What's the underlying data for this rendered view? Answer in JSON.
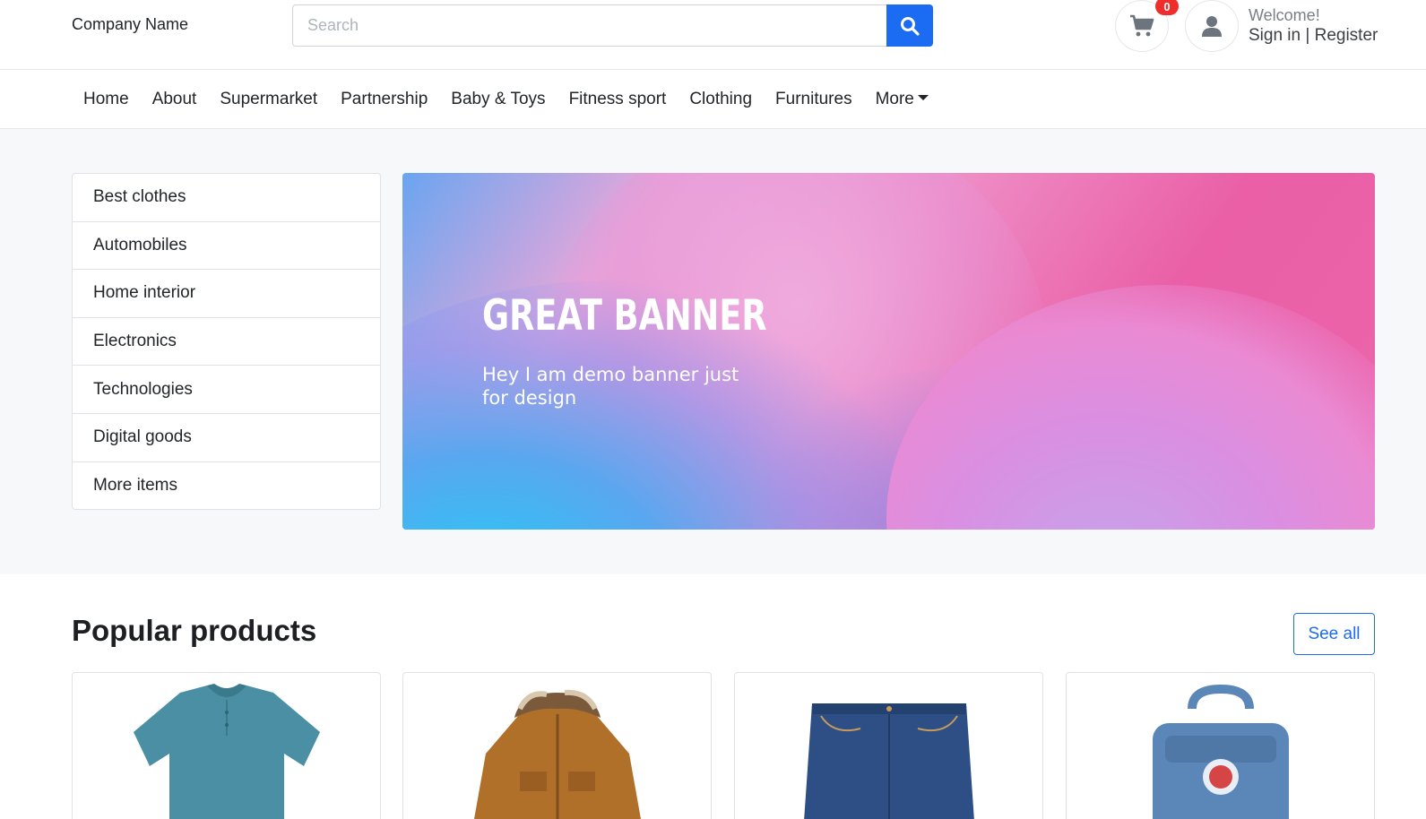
{
  "header": {
    "company": "Company Name",
    "search_placeholder": "Search",
    "search_value": "",
    "cart_count": "0",
    "welcome": "Welcome!",
    "sign_in": "Sign in",
    "separator": " | ",
    "register": "Register"
  },
  "nav": {
    "items": [
      "Home",
      "About",
      "Supermarket",
      "Partnership",
      "Baby & Toys",
      "Fitness sport",
      "Clothing",
      "Furnitures",
      "More"
    ]
  },
  "categories": {
    "items": [
      "Best clothes",
      "Automobiles",
      "Home interior",
      "Electronics",
      "Technologies",
      "Digital goods",
      "More items"
    ]
  },
  "banner": {
    "title": "GREAT BANNER",
    "subtitle": "Hey I am demo banner just for design"
  },
  "popular": {
    "title": "Popular products",
    "see_all": "See all",
    "products": [
      {
        "icon": "polo-shirt-icon",
        "color": "#4a8fa3"
      },
      {
        "icon": "jacket-icon",
        "color": "#b0702a"
      },
      {
        "icon": "jeans-icon",
        "color": "#2d4f86"
      },
      {
        "icon": "backpack-icon",
        "color": "#5a87b8"
      }
    ]
  },
  "colors": {
    "accent": "#1b6cf2",
    "badge": "#f02d2d"
  }
}
